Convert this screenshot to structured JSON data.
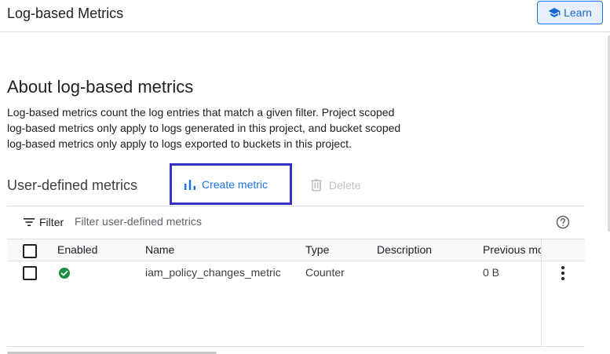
{
  "header": {
    "title": "Log-based Metrics",
    "learn_label": "Learn"
  },
  "about": {
    "title": "About log-based metrics",
    "lines": [
      "Log-based metrics count the log entries that match a given filter. Project scoped",
      "log-based metrics only apply to logs generated in this project, and bucket scoped",
      "log-based metrics only apply to logs exported to buckets in this project."
    ]
  },
  "metrics": {
    "title": "User-defined metrics",
    "create_label": "Create metric",
    "delete_label": "Delete"
  },
  "filter": {
    "label": "Filter",
    "placeholder": "Filter user-defined metrics"
  },
  "table": {
    "columns": [
      "Enabled",
      "Name",
      "Type",
      "Description",
      "Previous mo"
    ],
    "rows": [
      {
        "enabled": true,
        "name": "iam_policy_changes_metric",
        "type": "Counter",
        "description": "",
        "previous_month": "0 B"
      }
    ]
  },
  "colors": {
    "accent": "#1a73e8",
    "highlight_border": "#3730c7",
    "enabled_green": "#1e8e3e"
  },
  "icons": {
    "learn": "school-icon",
    "create": "bar-chart-icon",
    "delete": "trash-icon",
    "filter": "filter-icon",
    "help": "help-icon",
    "enabled": "check-circle-icon",
    "row_menu": "more-vert-icon"
  }
}
